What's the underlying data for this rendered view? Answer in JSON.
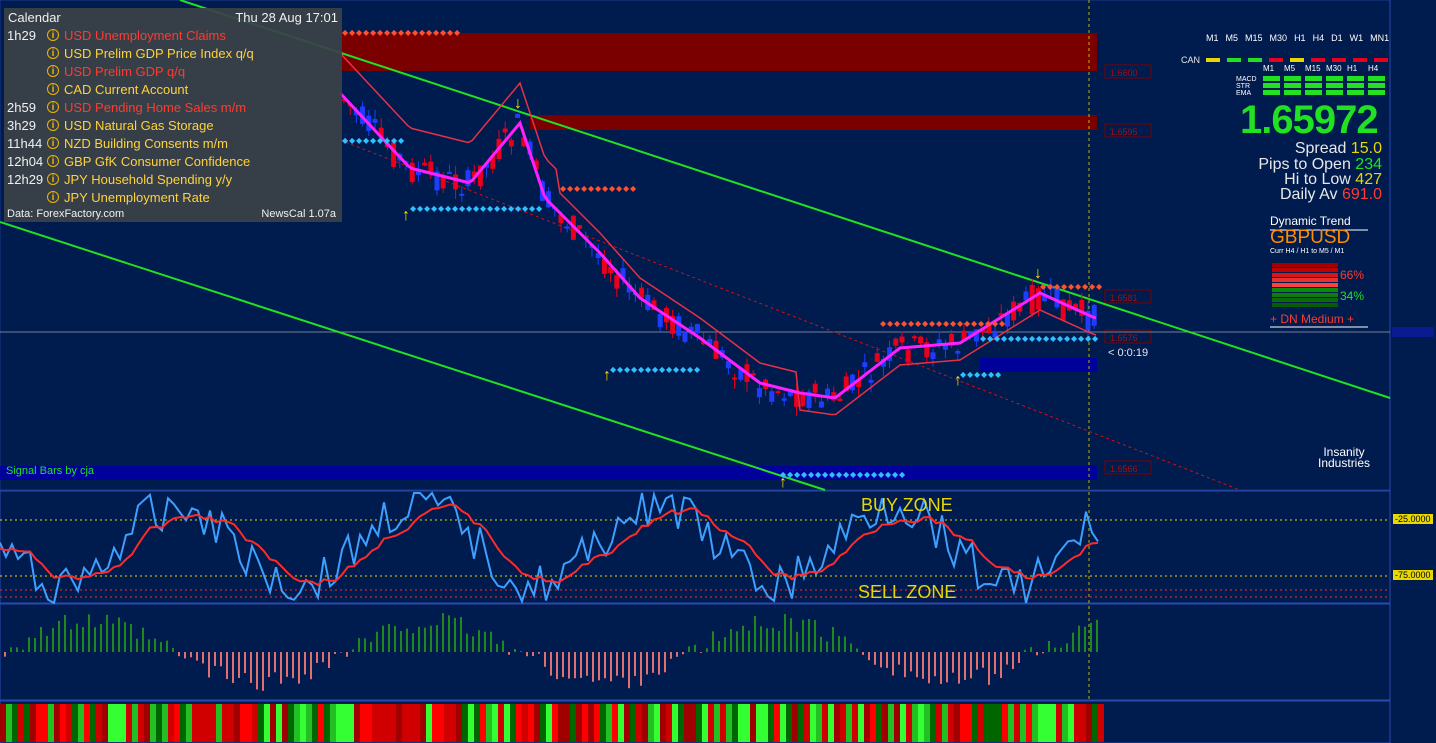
{
  "calendar": {
    "title": "Calendar",
    "datetime": "Thu 28 Aug 17:01",
    "events": [
      {
        "time": "1h29",
        "text": "USD Unemployment Claims",
        "color": "#ff3b2f"
      },
      {
        "time": "",
        "text": "USD Prelim GDP Price Index q/q",
        "color": "#ffd23a"
      },
      {
        "time": "",
        "text": "USD Prelim GDP q/q",
        "color": "#ff3b2f"
      },
      {
        "time": "",
        "text": "CAD Current Account",
        "color": "#ffd23a"
      },
      {
        "time": "2h59",
        "text": "USD Pending Home Sales m/m",
        "color": "#ff3b2f"
      },
      {
        "time": "3h29",
        "text": "USD Natural Gas Storage",
        "color": "#ffd23a"
      },
      {
        "time": "11h44",
        "text": "NZD Building Consents m/m",
        "color": "#ffd23a"
      },
      {
        "time": "12h04",
        "text": "GBP GfK Consumer Confidence",
        "color": "#ffd23a"
      },
      {
        "time": "12h29",
        "text": "JPY Household Spending y/y",
        "color": "#ffd23a"
      },
      {
        "time": "",
        "text": "JPY Unemployment Rate",
        "color": "#ffd23a"
      }
    ],
    "source": "Data: ForexFactory.com",
    "version": "NewsCal 1.07a"
  },
  "timeframes": [
    "M1",
    "M5",
    "M15",
    "M30",
    "H1",
    "H4",
    "D1",
    "W1",
    "MN1"
  ],
  "can_label": "CAN",
  "indicator_timeframes": [
    "M1",
    "M5",
    "M15",
    "M30",
    "H1",
    "H4"
  ],
  "indicator_labels": [
    "MACD",
    "STR",
    "EMA"
  ],
  "price": "1.65972",
  "stats": {
    "spread_label": "Spread",
    "spread_value": "15.0",
    "pips_label": "Pips to Open",
    "pips_value": "234",
    "hilo_label": "Hi to Low",
    "hilo_value": "427",
    "daily_label": "Daily Av",
    "daily_value": "691.0"
  },
  "dynamic_trend": {
    "title": "Dynamic Trend",
    "symbol": "GBPUSD",
    "sub": "Curr  H4 / H1   to   M5 / M1",
    "pct_down": "66%",
    "pct_up": "34%",
    "status": "+ DN Medium +"
  },
  "price_tags": [
    "1.6600",
    "1.6595",
    "1.6581",
    "1.6576",
    "1.6566"
  ],
  "countdown": "< 0:0:19",
  "signal_bars_label": "Signal Bars by cja",
  "zones": {
    "buy": "BUY ZONE",
    "sell": "SELL ZONE"
  },
  "levels": {
    "upper": "-25.0000",
    "lower": "-75.0000"
  },
  "logo": {
    "line1": "Insanity",
    "line2": "Industries"
  },
  "colors": {
    "background": "#001b4d",
    "bull_candle": "#1f3dff",
    "bear_candle": "#e8001c",
    "trend_line": "#22e022",
    "supply_zone": "#7a0000",
    "demand_zone": "#00009a",
    "osc_main": "#3da0ff",
    "osc_signal": "#ff2a2a"
  }
}
